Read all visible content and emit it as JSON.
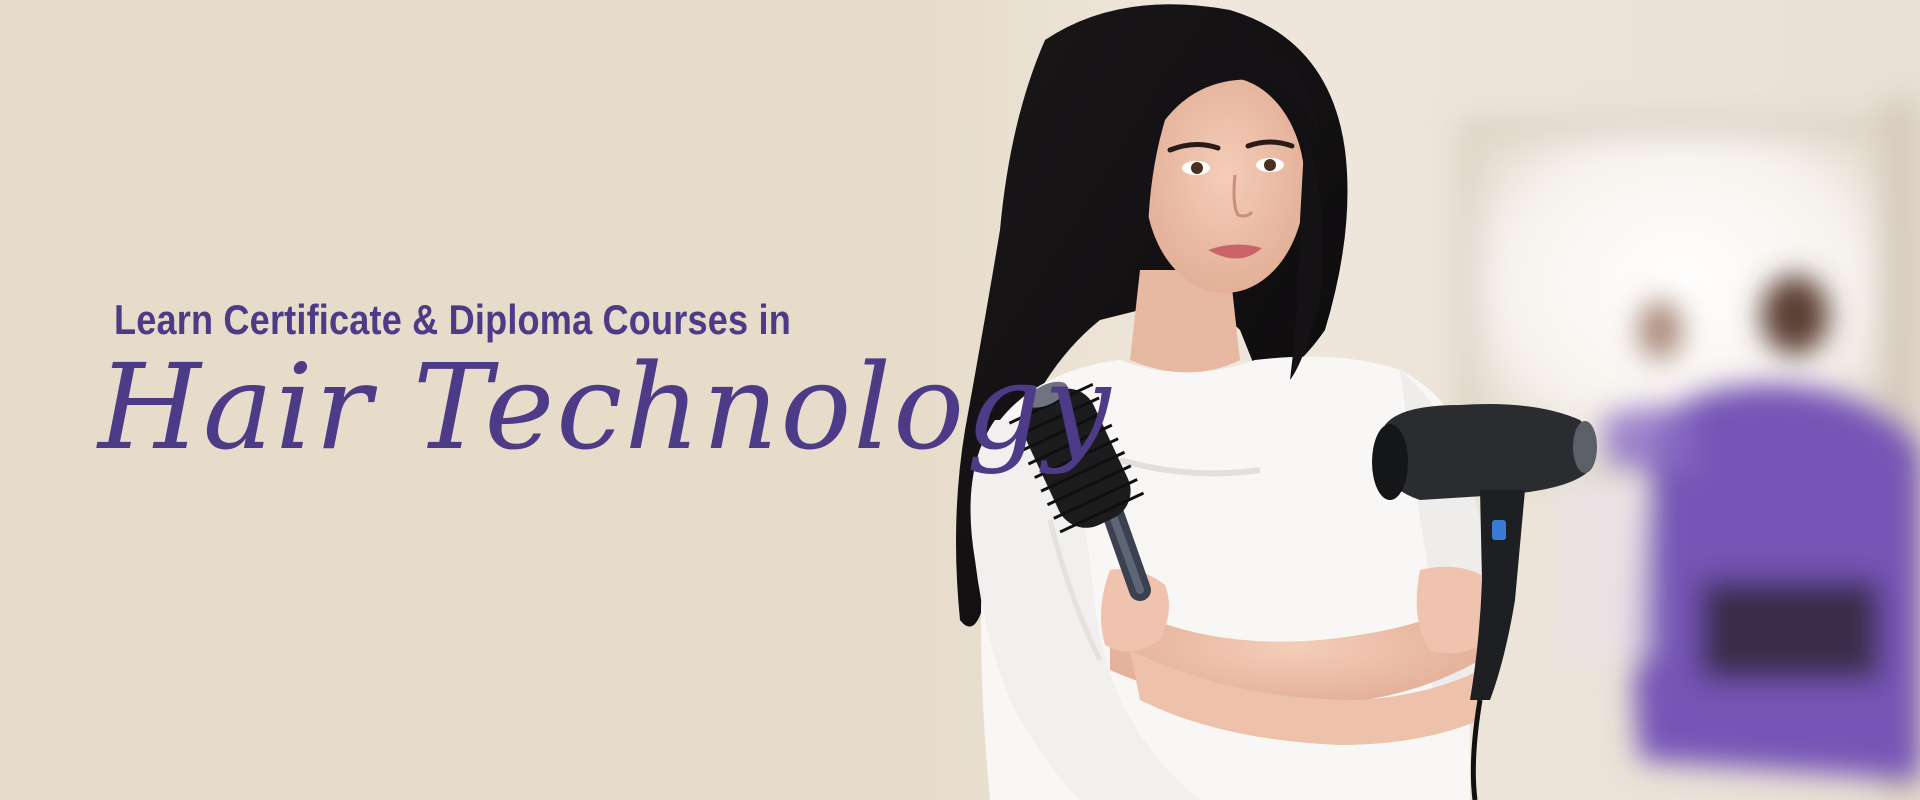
{
  "banner": {
    "headline": "Learn Certificate & Diploma Courses in",
    "title": "Hair Technology",
    "colors": {
      "text": "#4d3b87",
      "background": "#e7dcca"
    }
  },
  "photo": {
    "subject": "stylist-with-brush-and-dryer"
  }
}
